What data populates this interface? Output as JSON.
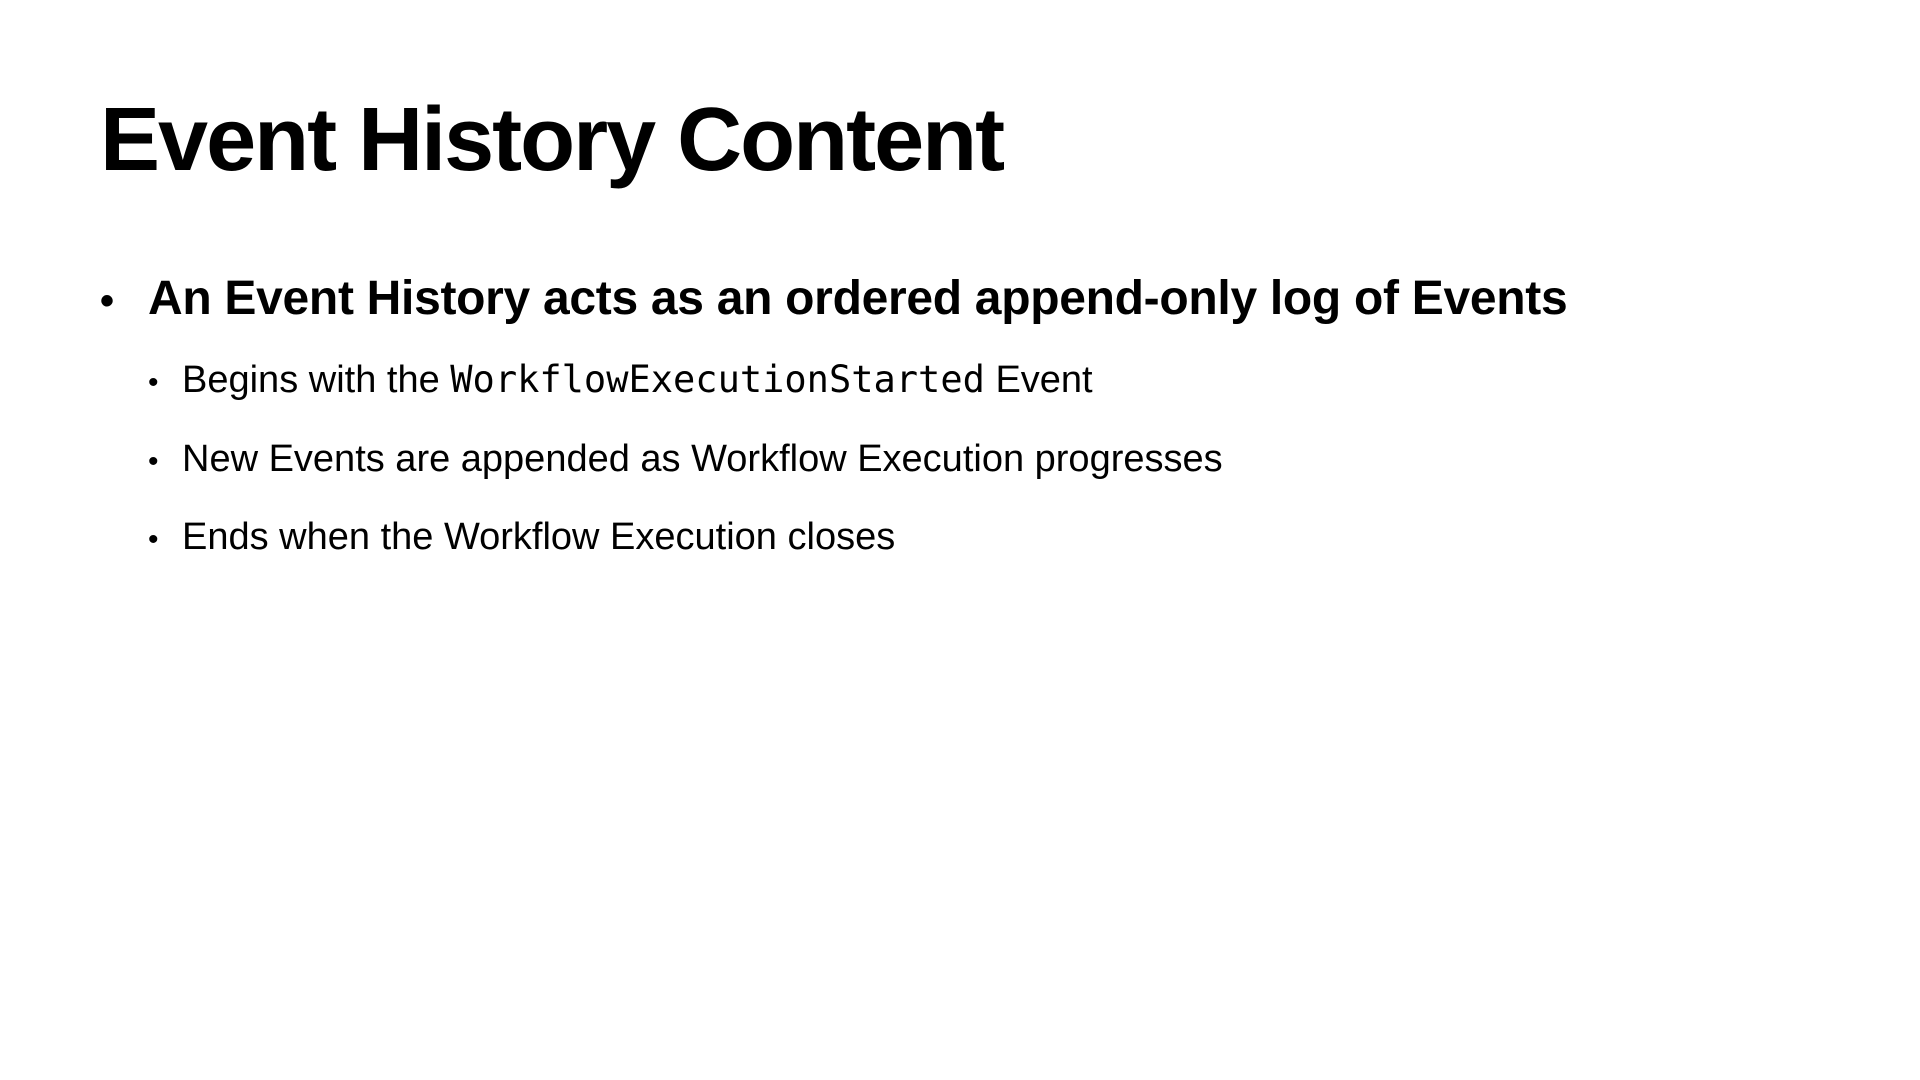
{
  "slide": {
    "title": "Event History Content",
    "main_bullet": {
      "marker": "•",
      "text": "An Event History acts as an ordered append-only log of Events"
    },
    "sub_bullets": [
      {
        "marker": "•",
        "prefix": "Begins with the ",
        "code": "WorkflowExecutionStarted",
        "suffix": " Event"
      },
      {
        "marker": "•",
        "text": "New Events are appended as Workflow Execution progresses"
      },
      {
        "marker": "•",
        "text": "Ends when the Workflow Execution closes"
      }
    ]
  }
}
